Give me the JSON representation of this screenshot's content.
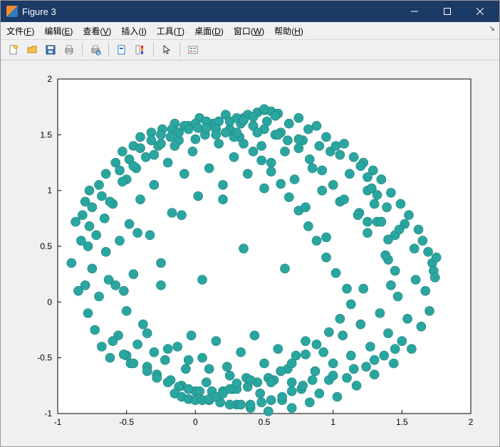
{
  "window": {
    "title": "Figure 3"
  },
  "menu": {
    "file": {
      "label": "文件",
      "accel": "F"
    },
    "edit": {
      "label": "编辑",
      "accel": "E"
    },
    "view": {
      "label": "查看",
      "accel": "V"
    },
    "insert": {
      "label": "插入",
      "accel": "I"
    },
    "tools": {
      "label": "工具",
      "accel": "T"
    },
    "desktop": {
      "label": "桌面",
      "accel": "D"
    },
    "window": {
      "label": "窗口",
      "accel": "W"
    },
    "help": {
      "label": "帮助",
      "accel": "H"
    }
  },
  "toolbar": {
    "new": "new-figure",
    "open": "open",
    "save": "save",
    "print": "print",
    "printpreview": "print-preview",
    "datacursor": "data-cursor",
    "colorbar": "insert-colorbar",
    "pointer": "edit-pointer",
    "legend": "insert-legend"
  },
  "chart_data": {
    "type": "scatter",
    "xlabel": "",
    "ylabel": "",
    "title": "",
    "xlim": [
      -1,
      2
    ],
    "ylim": [
      -1,
      2
    ],
    "xticks": [
      -1,
      -0.5,
      0,
      0.5,
      1,
      1.5,
      2
    ],
    "yticks": [
      -1,
      -0.5,
      0,
      0.5,
      1,
      1.5,
      2
    ],
    "marker_color": "#2aa6a0",
    "marker_edge": "#1e7d78",
    "marker_radius_px": 6.5,
    "series": [
      {
        "name": "points",
        "x": [
          -0.9,
          -0.87,
          -0.85,
          -0.83,
          -0.82,
          -0.8,
          -0.8,
          -0.78,
          -0.78,
          -0.77,
          -0.77,
          -0.75,
          -0.75,
          -0.73,
          -0.72,
          -0.7,
          -0.7,
          -0.68,
          -0.68,
          -0.66,
          -0.65,
          -0.63,
          -0.62,
          -0.6,
          -0.58,
          -0.56,
          -0.55,
          -0.53,
          -0.52,
          -0.5,
          -0.5,
          -0.48,
          -0.47,
          -0.45,
          -0.45,
          -0.43,
          -0.42,
          -0.4,
          -0.4,
          -0.38,
          -0.36,
          -0.35,
          -0.33,
          -0.32,
          -0.3,
          -0.3,
          -0.28,
          -0.27,
          -0.25,
          -0.24,
          -0.22,
          -0.2,
          -0.18,
          -0.17,
          -0.15,
          -0.13,
          -0.12,
          -0.1,
          -0.08,
          -0.07,
          -0.05,
          -0.03,
          -0.02,
          0.0,
          0.02,
          0.03,
          0.05,
          0.07,
          0.08,
          0.1,
          0.12,
          0.13,
          0.15,
          0.17,
          0.18,
          0.2,
          0.22,
          0.23,
          0.25,
          0.27,
          0.28,
          0.3,
          0.32,
          0.33,
          0.35,
          0.37,
          0.38,
          0.4,
          0.42,
          0.43,
          0.45,
          0.47,
          0.48,
          0.5,
          0.52,
          0.53,
          0.55,
          0.57,
          0.58,
          0.6,
          0.62,
          0.63,
          0.65,
          0.67,
          0.68,
          0.7,
          0.72,
          0.73,
          0.75,
          0.77,
          0.78,
          0.8,
          0.82,
          0.83,
          0.85,
          0.87,
          0.88,
          0.9,
          0.92,
          0.93,
          0.95,
          0.97,
          0.98,
          1.0,
          1.02,
          1.03,
          1.05,
          1.07,
          1.08,
          1.1,
          1.12,
          1.13,
          1.15,
          1.17,
          1.19,
          1.2,
          1.22,
          1.24,
          1.25,
          1.27,
          1.29,
          1.3,
          1.32,
          1.34,
          1.35,
          1.37,
          1.39,
          1.4,
          1.42,
          1.44,
          1.45,
          1.47,
          1.49,
          1.5,
          1.52,
          1.54,
          1.55,
          1.57,
          1.59,
          1.6,
          1.62,
          1.64,
          1.65,
          1.67,
          1.69,
          1.7,
          1.72,
          1.73,
          1.74,
          1.75,
          -0.6,
          -0.55,
          -0.52,
          -0.48,
          -0.45,
          -0.4,
          -0.35,
          -0.32,
          -0.28,
          -0.25,
          -0.2,
          -0.17,
          -0.12,
          -0.08,
          -0.05,
          0.0,
          0.03,
          0.08,
          0.12,
          0.17,
          0.2,
          0.25,
          0.3,
          0.33,
          0.38,
          0.42,
          0.45,
          0.5,
          0.53,
          0.58,
          0.62,
          0.67,
          0.7,
          0.75,
          0.8,
          0.83,
          0.88,
          0.92,
          0.97,
          1.0,
          1.05,
          1.08,
          1.13,
          1.18,
          1.22,
          1.25,
          -0.25,
          -0.18,
          -0.12,
          -0.05,
          0.02,
          0.08,
          0.15,
          0.22,
          0.28,
          0.35,
          0.42,
          0.48,
          0.55,
          0.62,
          0.68,
          0.75,
          0.82,
          0.88,
          0.95,
          1.02,
          -0.65,
          -0.62,
          -0.58,
          -0.53,
          -0.5,
          -0.45,
          -0.42,
          -0.35,
          -0.3,
          -0.25,
          -0.2,
          -0.15,
          -0.1,
          -0.05,
          0.0,
          0.05,
          0.1,
          0.15,
          0.2,
          0.25,
          0.3,
          0.35,
          0.4,
          0.45,
          0.5,
          0.55,
          0.6,
          0.65,
          0.7,
          0.75,
          0.8,
          0.85,
          0.9,
          0.95,
          1.0,
          1.05,
          1.1,
          1.15,
          1.2,
          1.25,
          1.3,
          1.35,
          1.4,
          1.45,
          0.1,
          0.18,
          0.25,
          0.33,
          0.4,
          0.48,
          0.55,
          0.63,
          0.7,
          0.78,
          0.45,
          0.5,
          0.38,
          0.55,
          0.3,
          0.6,
          0.42,
          0.5,
          0.35,
          0.58,
          1.3,
          1.35,
          1.28,
          1.4,
          1.25,
          1.38,
          1.45,
          1.32,
          1.42,
          1.48,
          -0.15,
          -0.1,
          -0.05,
          0.0,
          0.05,
          0.1,
          0.15,
          0.2,
          0.25,
          0.3
        ],
        "y": [
          0.35,
          0.72,
          0.1,
          0.55,
          0.78,
          0.15,
          0.9,
          0.5,
          -0.1,
          0.68,
          1.0,
          0.3,
          0.85,
          -0.25,
          0.6,
          1.05,
          0.05,
          0.95,
          -0.4,
          0.75,
          1.15,
          0.2,
          -0.5,
          0.88,
          1.25,
          -0.3,
          0.55,
          1.35,
          0.1,
          -0.48,
          1.1,
          0.7,
          -0.55,
          1.4,
          0.25,
          1.2,
          -0.38,
          0.92,
          1.48,
          -0.2,
          1.3,
          -0.58,
          0.6,
          1.52,
          -0.45,
          1.05,
          -0.65,
          1.4,
          0.15,
          1.55,
          -0.52,
          1.25,
          -0.7,
          0.8,
          1.6,
          -0.4,
          1.45,
          -0.75,
          1.15,
          -0.6,
          1.58,
          -0.3,
          1.35,
          -0.8,
          0.95,
          1.65,
          -0.5,
          1.5,
          -0.72,
          1.2,
          -0.85,
          1.6,
          -0.35,
          1.42,
          -0.9,
          1.05,
          1.68,
          -0.58,
          1.55,
          -0.78,
          1.3,
          -0.92,
          1.48,
          -0.45,
          1.65,
          -0.68,
          1.15,
          -0.95,
          1.58,
          -0.3,
          1.7,
          -0.82,
          1.4,
          -0.55,
          1.62,
          -0.98,
          1.25,
          -0.7,
          1.68,
          -0.42,
          1.52,
          -0.88,
          1.35,
          -0.6,
          1.6,
          -0.95,
          1.1,
          -0.48,
          1.65,
          -0.78,
          1.45,
          -0.35,
          1.55,
          -0.9,
          1.2,
          -0.62,
          1.58,
          -0.82,
          1.0,
          -0.45,
          1.48,
          -0.7,
          1.35,
          -0.55,
          1.4,
          -0.85,
          0.9,
          -0.3,
          1.42,
          -0.68,
          1.15,
          -0.48,
          1.3,
          -0.75,
          0.8,
          -0.2,
          1.25,
          -0.58,
          1.0,
          -0.4,
          1.18,
          -0.65,
          0.72,
          -0.1,
          1.1,
          -0.48,
          0.85,
          -0.28,
          0.98,
          -0.55,
          0.6,
          0.05,
          0.88,
          -0.35,
          0.7,
          -0.15,
          0.78,
          -0.42,
          0.48,
          0.2,
          0.65,
          -0.22,
          0.55,
          0.1,
          0.45,
          -0.08,
          0.35,
          0.28,
          0.22,
          0.4,
          -0.35,
          1.18,
          -0.47,
          1.28,
          -0.55,
          1.38,
          -0.62,
          1.45,
          -0.68,
          1.5,
          -0.72,
          1.55,
          -0.76,
          1.58,
          -0.78,
          1.6,
          -0.8,
          1.62,
          -0.8,
          1.62,
          -0.8,
          1.62,
          -0.78,
          1.6,
          -0.76,
          1.58,
          -0.72,
          1.55,
          -0.68,
          1.5,
          -0.62,
          1.45,
          -0.55,
          1.38,
          -0.47,
          1.28,
          -0.38,
          1.18,
          -0.27,
          1.05,
          -0.15,
          0.92,
          -0.02,
          0.78,
          0.12,
          0.62,
          1.42,
          1.48,
          1.52,
          1.55,
          1.56,
          1.56,
          1.55,
          1.52,
          1.48,
          1.42,
          1.35,
          1.27,
          1.17,
          1.06,
          0.94,
          0.82,
          0.68,
          0.55,
          0.4,
          0.26,
          0.45,
          0.9,
          0.15,
          1.08,
          -0.08,
          1.22,
          0.62,
          -0.28,
          1.32,
          0.35,
          -0.42,
          1.4,
          0.78,
          -0.52,
          1.46,
          0.2,
          -0.6,
          1.5,
          0.92,
          -0.66,
          1.52,
          0.48,
          -0.7,
          1.52,
          1.02,
          -0.72,
          1.5,
          0.3,
          -0.72,
          1.46,
          0.85,
          -0.7,
          1.4,
          0.58,
          -0.66,
          1.32,
          0.12,
          -0.6,
          1.22,
          0.72,
          -0.52,
          1.1,
          0.38,
          -0.42,
          -0.88,
          -0.9,
          -0.92,
          -0.92,
          -0.92,
          -0.9,
          -0.88,
          -0.85,
          -0.8,
          -0.75,
          1.7,
          1.72,
          1.68,
          1.71,
          1.65,
          1.69,
          1.66,
          1.73,
          1.63,
          1.67,
          0.88,
          0.72,
          1.02,
          0.56,
          1.12,
          0.42,
          0.28,
          0.96,
          0.15,
          0.65,
          -0.82,
          -0.85,
          -0.87,
          -0.88,
          -0.88,
          -0.87,
          -0.85,
          -0.82,
          -0.78,
          -0.73
        ]
      }
    ]
  }
}
